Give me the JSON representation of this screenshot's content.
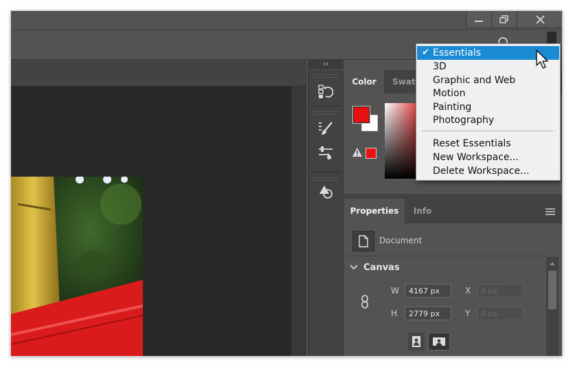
{
  "window": {
    "minimize_icon": "minimize-icon",
    "restore_icon": "restore-icon",
    "close_icon": "close-icon"
  },
  "toolbar": {
    "collapse_label": "‹‹"
  },
  "color_panel": {
    "tabs": [
      {
        "label": "Color",
        "active": true
      },
      {
        "label": "Swatches",
        "active": false
      }
    ],
    "foreground_color": "#e81010",
    "background_color": "#ffffff",
    "gamut_warning_color": "#e81010"
  },
  "workspace_menu": {
    "items": [
      {
        "label": "Essentials",
        "checked": true,
        "highlighted": true
      },
      {
        "label": "3D"
      },
      {
        "label": "Graphic and Web"
      },
      {
        "label": "Motion"
      },
      {
        "label": "Painting"
      },
      {
        "label": "Photography"
      }
    ],
    "actions": [
      {
        "label": "Reset Essentials"
      },
      {
        "label": "New Workspace..."
      },
      {
        "label": "Delete Workspace..."
      }
    ]
  },
  "properties_panel": {
    "tabs": [
      {
        "label": "Properties",
        "active": true
      },
      {
        "label": "Info",
        "active": false
      }
    ],
    "document_label": "Document",
    "canvas_section": "Canvas",
    "width_label": "W",
    "width_value": "4167 px",
    "height_label": "H",
    "height_value": "2779 px",
    "x_label": "X",
    "x_placeholder": "0 px",
    "y_label": "Y",
    "y_placeholder": "0 px"
  },
  "colors": {
    "selection": "#1a8ad4",
    "panel_bg": "#535353",
    "dark_bg": "#282828"
  }
}
